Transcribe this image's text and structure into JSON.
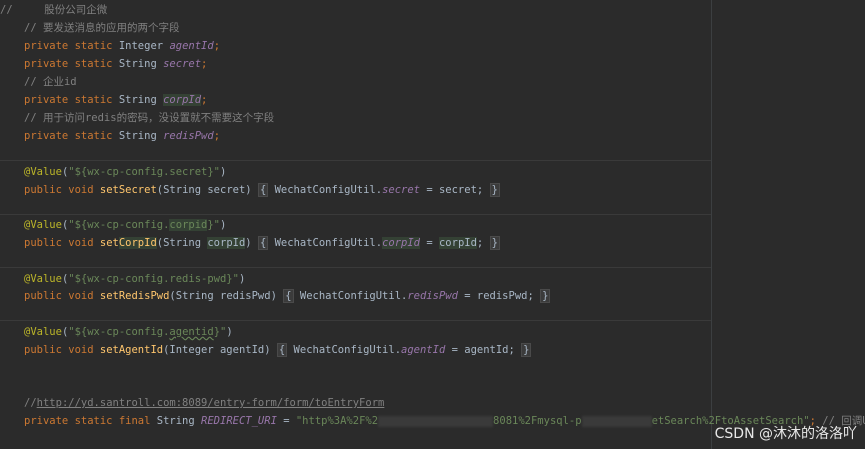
{
  "code": {
    "l1": "//     股份公司企微",
    "l2": "// 要发送消息的应用的两个字段",
    "l3_kw": "private static",
    "l3_type": "Integer",
    "l3_field": "agentId",
    "l4_kw": "private static",
    "l4_type": "String",
    "l4_field": "secret",
    "l5": "// 企业id",
    "l6_kw": "private static",
    "l6_type": "String",
    "l6_field": "corpId",
    "l7": "// 用于访问redis的密码，没设置就不需要这个字段",
    "l8_kw": "private static",
    "l8_type": "String",
    "l8_field": "redisPwd",
    "a1_ann": "@Value",
    "a1_str1": "\"${wx-cp-config.secret}\"",
    "m1_kw": "public void",
    "m1_fn": "setSecret",
    "m1_params": "(String secret)",
    "m1_body_cls": "WechatConfigUtil.",
    "m1_body_field": "secret",
    "m1_body_rest": " = secret;",
    "a2_ann": "@Value",
    "a2_str_pre": "\"${wx-cp-config.",
    "a2_str_hl": "corpid",
    "a2_str_post": "}\"",
    "m2_kw": "public void",
    "m2_fn_pre": "set",
    "m2_fn_hl": "CorpId",
    "m2_params_pre": "(String ",
    "m2_params_hl": "corpId",
    "m2_params_post": ")",
    "m2_body_cls": "WechatConfigUtil.",
    "m2_body_field": "corpId",
    "m2_body_eq": " = ",
    "m2_body_hl": "corpId",
    "m2_body_end": ";",
    "a3_ann": "@Value",
    "a3_str": "\"${wx-cp-config.redis-pwd}\"",
    "m3_kw": "public void",
    "m3_fn": "setRedisPwd",
    "m3_params": "(String redisPwd)",
    "m3_body_cls": "WechatConfigUtil.",
    "m3_body_field": "redisPwd",
    "m3_body_rest": " = redisPwd;",
    "a4_ann": "@Value",
    "a4_str_pre": "\"${wx-cp-config.",
    "a4_str_wave": "agentid",
    "a4_str_post": "}\"",
    "m4_kw": "public void",
    "m4_fn": "setAgentId",
    "m4_params": "(Integer agentId)",
    "m4_body_cls": "WechatConfigUtil.",
    "m4_body_field": "agentId",
    "m4_body_rest": " = agentId;",
    "c_link_prefix": "//",
    "c_link": "http://yd.santroll.com:8089/entry-form/form/toEntryForm",
    "last_kw": "private static final",
    "last_type": "String",
    "last_field": "REDIRECT_URI",
    "last_eq": " = ",
    "last_str1": "\"http%3A%2F%2",
    "last_str2": "8081%2Fmysql-p",
    "last_str3": "etSearch%2FtoAssetSearch\"",
    "last_semi": ";",
    "last_comment": " // 回调URL"
  },
  "watermark": "CSDN @沐沐的洛洛吖"
}
